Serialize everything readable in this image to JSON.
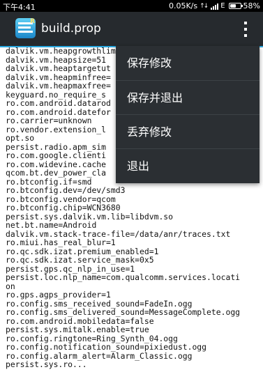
{
  "status_bar": {
    "time": "下午4:41",
    "speed": "0.05K/s",
    "network": "E",
    "battery": "58%",
    "battery_level": 0.58
  },
  "action_bar": {
    "title": "build.prop",
    "app_icon": "build-prop-editor-icon",
    "overflow_icon": "overflow-menu-icon",
    "accent_color": "#29a8e0"
  },
  "editor_lines": [
    "dalvik.vm.heapgrowthlimit=",
    "dalvik.vm.heapsize=51",
    "dalvik.vm.heaptargetut",
    "dalvik.vm.heapminfree=",
    "dalvik.vm.heapmaxfree=",
    "keyguard.no_require_s",
    "ro.com.android.datarod",
    "ro.com.android.datefor",
    "ro.carrier=unknown",
    "ro.vendor.extension_l",
    "opt.so",
    "persist.radio.apm_sim",
    "ro.com.google.clienti",
    "ro.com.widevine.cache",
    "qcom.bt.dev_power_cla",
    "ro.btconfig.if=smd",
    "ro.btconfig.dev=/dev/smd3",
    "ro.btconfig.vendor=qcom",
    "ro.btconfig.chip=WCN3680",
    "persist.sys.dalvik.vm.lib=libdvm.so",
    "net.bt.name=Android",
    "dalvik.vm.stack-trace-file=/data/anr/traces.txt",
    "ro.miui.has_real_blur=1",
    "ro.qc.sdk.izat.premium_enabled=1",
    "ro.qc.sdk.izat.service_mask=0x5",
    "persist.gps.qc_nlp_in_use=1",
    "persist.loc.nlp_name=com.qualcomm.services.locati",
    "on",
    "ro.gps.agps_provider=1",
    "ro.config.sms_received_sound=FadeIn.ogg",
    "ro.config.sms_delivered_sound=MessageComplete.ogg",
    "ro.com.android.mobiledata=false",
    "persist.sys.mitalk.enable=true",
    "ro.config.ringtone=Ring_Synth_04.ogg",
    "ro.config.notification_sound=pixiedust.ogg",
    "ro.config.alarm_alert=Alarm_Classic.ogg",
    "persist.sys.ro..."
  ],
  "menu": {
    "items": [
      {
        "label": "保存修改"
      },
      {
        "label": "保存并退出"
      },
      {
        "label": "丢弃修改"
      },
      {
        "label": "退出"
      }
    ]
  }
}
